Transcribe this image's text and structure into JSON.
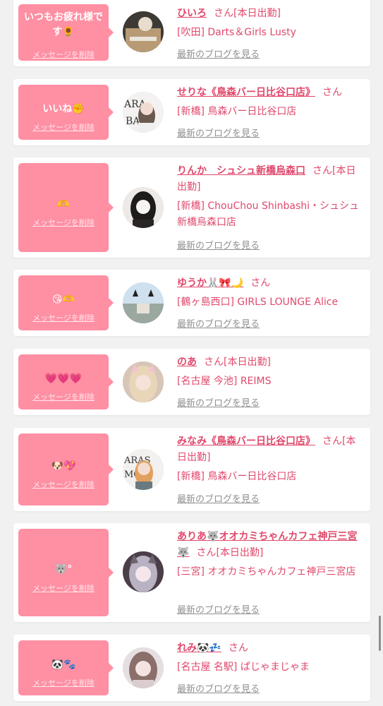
{
  "colors": {
    "bubble": "#ff8fa3",
    "accent": "#e0486b",
    "muted": "#909090",
    "background": "#f1f1f1"
  },
  "delete_label": "メッセージを削除",
  "san_label": "さん",
  "blog_label": "最新のブログを見る",
  "entries": [
    {
      "message": "いつもお疲れ様です🌻",
      "name": "ひいろ",
      "status": "[本日出勤]",
      "shop": "[吹田] Darts＆Girls Lusty",
      "avatar_icon": "avatar-photo-icon"
    },
    {
      "message": "いいね✊",
      "name": "せりな《鳥森バー日比谷口店》",
      "status": "",
      "shop": "[新橋] 鳥森バー日比谷口店",
      "avatar_icon": "avatar-photo-icon"
    },
    {
      "message": "🫶",
      "name": "りんか　シュシュ新橋烏森口",
      "status": "[本日出勤]",
      "shop": "[新橋] ChouChou Shinbashi・シュシュ新橋烏森口店",
      "avatar_icon": "avatar-photo-icon"
    },
    {
      "message": "😘🫶",
      "name": "ゆうか🐰🎀🌙",
      "status": "",
      "shop": "[鶴ヶ島西口] GIRLS LOUNGE Alice",
      "avatar_icon": "avatar-photo-icon"
    },
    {
      "message": "💗💗💗",
      "name": "のあ",
      "status": "[本日出勤]",
      "shop": "[名古屋 今池] REIMS",
      "avatar_icon": "avatar-photo-icon"
    },
    {
      "message": "🐶💖",
      "name": "みなみ《鳥森バー日比谷口店》",
      "status": "[本日出勤]",
      "shop": "[新橋] 鳥森バー日比谷口店",
      "avatar_icon": "avatar-photo-icon"
    },
    {
      "message": "🐺°",
      "name": "ありあ🐺オオカミちゃんカフェ神戸三宮🐺",
      "status": "[本日出勤]",
      "shop": "[三宮] オオカミちゃんカフェ神戸三宮店",
      "avatar_icon": "avatar-photo-icon"
    },
    {
      "message": "🐼🐾",
      "name": "れみ🐼💤",
      "status": "",
      "shop": "[名古屋 名駅] ぱじゃまじゃま",
      "avatar_icon": "avatar-photo-icon"
    }
  ]
}
